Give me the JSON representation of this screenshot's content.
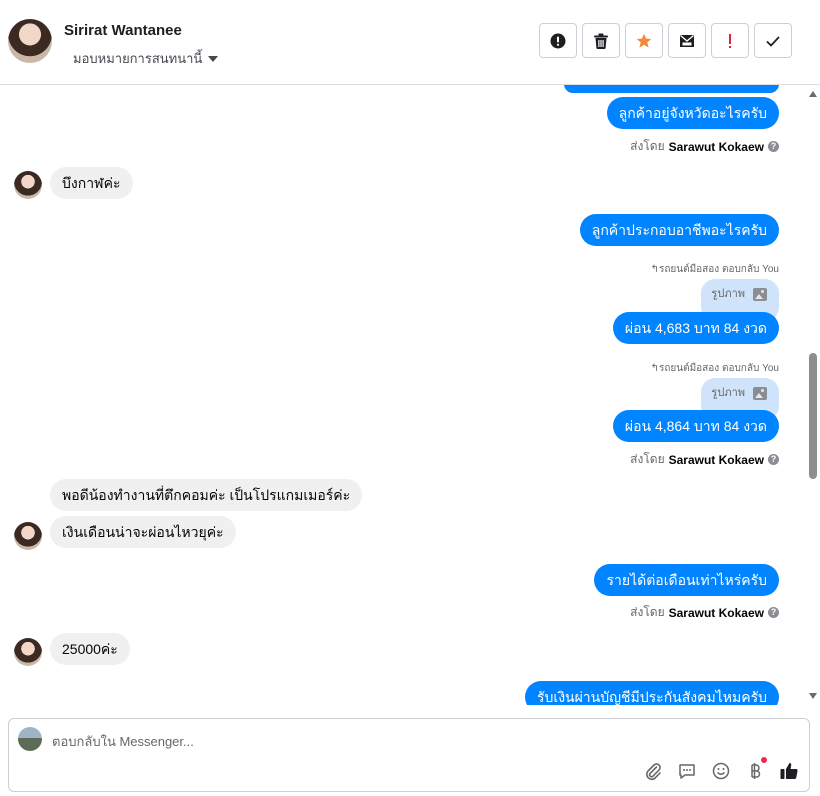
{
  "header": {
    "contact_name": "Sirirat Wantanee",
    "assign_label": "มอบหมายการสนทนานี้",
    "actions": [
      {
        "name": "spam-report-button",
        "icon": "alert-circle-icon",
        "color": "#1c1e21"
      },
      {
        "name": "delete-button",
        "icon": "trash-icon",
        "color": "#1c1e21"
      },
      {
        "name": "star-button",
        "icon": "star-icon",
        "color": "#f5883a"
      },
      {
        "name": "mark-unread-button",
        "icon": "envelope-icon",
        "color": "#1c1e21"
      },
      {
        "name": "follow-up-button",
        "icon": "exclamation-icon",
        "color": "#e41e3f"
      },
      {
        "name": "mark-done-button",
        "icon": "check-icon",
        "color": "#1c1e21"
      }
    ]
  },
  "messages": {
    "m1": "ลูกค้าอยู่จังหวัดอะไรครับ",
    "m2": "บึงกาฬค่ะ",
    "m3": "ลูกค้าประกอบอาชีพอะไรครับ",
    "m4": "ผ่อน 4,683 บาท 84 งวด",
    "m5": "ผ่อน 4,864 บาท 84 งวด",
    "m6": "พอดีน้องทำงานที่ตึกคอมค่ะ เป็นโปรแกมเมอร์ค่ะ",
    "m7": "เงินเดือนน่าจะผ่อนไหวยุค่ะ",
    "m8": "รายได้ต่อเดือนเท่าไหร่ครับ",
    "m9": "25000ค่ะ",
    "m10": "รับเงินผ่านบัญชีมีประกันสังคมไหมครับ"
  },
  "reply_note": "↰รถยนต์มือสอง ตอบกลับ You",
  "reply_ref_label": "รูปภาพ",
  "sent_by": {
    "prefix": "ส่งโดย",
    "name": "Sarawut Kokaew"
  },
  "composer": {
    "placeholder": "ตอบกลับใน Messenger...",
    "value": ""
  },
  "colors": {
    "outgoing": "#0084ff",
    "incoming": "#f0f0f0",
    "reply_ref": "#cfe4fb"
  }
}
